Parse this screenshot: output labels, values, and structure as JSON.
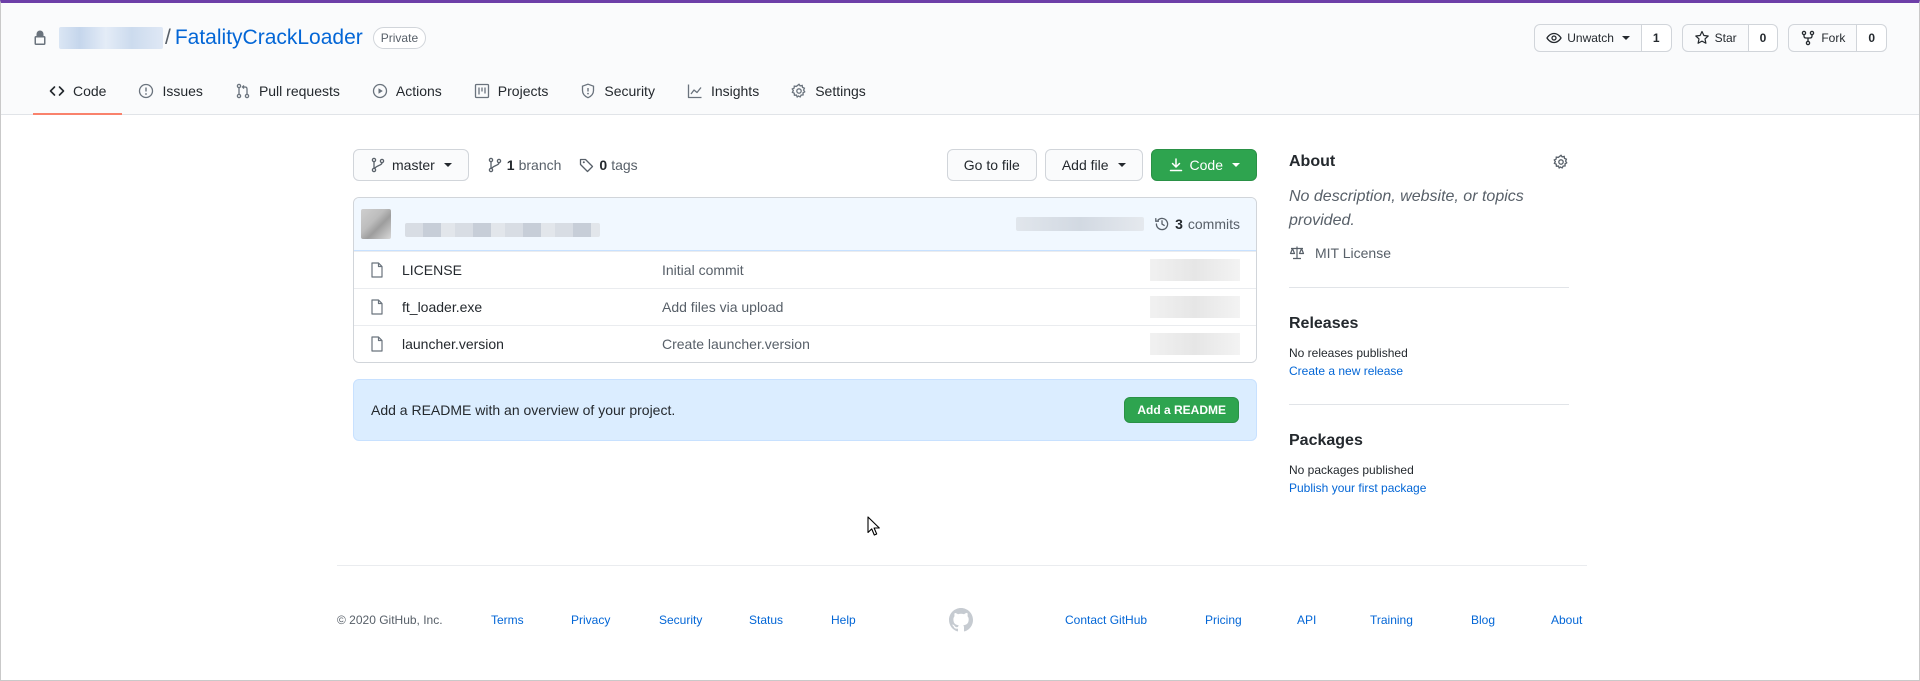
{
  "repo": {
    "name": "FatalityCrackLoader",
    "visibility": "Private",
    "separator": "/"
  },
  "actions": {
    "watch_label": "Unwatch",
    "watch_count": "1",
    "star_label": "Star",
    "star_count": "0",
    "fork_label": "Fork",
    "fork_count": "0"
  },
  "nav": [
    {
      "label": "Code",
      "icon": "code-icon",
      "selected": true
    },
    {
      "label": "Issues",
      "icon": "issue-icon"
    },
    {
      "label": "Pull requests",
      "icon": "pull-request-icon"
    },
    {
      "label": "Actions",
      "icon": "play-icon"
    },
    {
      "label": "Projects",
      "icon": "project-icon"
    },
    {
      "label": "Security",
      "icon": "shield-icon"
    },
    {
      "label": "Insights",
      "icon": "graph-icon"
    },
    {
      "label": "Settings",
      "icon": "gear-icon"
    }
  ],
  "file_nav": {
    "branch": "master",
    "branch_count": "1",
    "branch_word": "branch",
    "tag_count": "0",
    "tag_word": "tags",
    "go_to_file": "Go to file",
    "add_file": "Add file",
    "code": "Code"
  },
  "commits": {
    "count": "3",
    "word": "commits"
  },
  "files": [
    {
      "name": "LICENSE",
      "message": "Initial commit"
    },
    {
      "name": "ft_loader.exe",
      "message": "Add files via upload"
    },
    {
      "name": "launcher.version",
      "message": "Create launcher.version"
    }
  ],
  "readme": {
    "text": "Add a README with an overview of your project.",
    "button": "Add a README"
  },
  "sidebar": {
    "about_title": "About",
    "about_text": "No description, website, or topics provided.",
    "license": "MIT License",
    "releases_title": "Releases",
    "releases_text": "No releases published",
    "releases_link": "Create a new release",
    "packages_title": "Packages",
    "packages_text": "No packages published",
    "packages_link": "Publish your first package"
  },
  "footer": {
    "copyright": "© 2020 GitHub, Inc.",
    "left_links": [
      "Terms",
      "Privacy",
      "Security",
      "Status",
      "Help"
    ],
    "right_links": [
      "Contact GitHub",
      "Pricing",
      "API",
      "Training",
      "Blog",
      "About"
    ]
  },
  "colors": {
    "accent_blue": "#0366d6",
    "green": "#2ea44f",
    "tab_underline": "#f9826c",
    "callout_bg": "#dbedff"
  }
}
